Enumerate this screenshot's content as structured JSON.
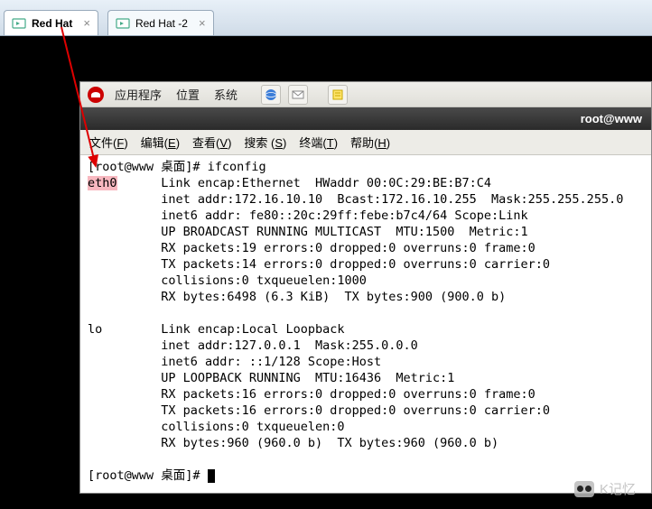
{
  "outer_tabs": [
    {
      "label": "Red Hat",
      "active": true
    },
    {
      "label": "Red Hat -2",
      "active": false
    }
  ],
  "gnome_panel": {
    "apps": "应用程序",
    "places": "位置",
    "system": "系统"
  },
  "window_title": "root@www",
  "menubar": {
    "file": {
      "label": "文件",
      "key": "F"
    },
    "edit": {
      "label": "编辑",
      "key": "E"
    },
    "view": {
      "label": "查看",
      "key": "V"
    },
    "search": {
      "label": "搜索",
      "key": "S"
    },
    "terminal": {
      "label": "终端",
      "key": "T"
    },
    "help": {
      "label": "帮助",
      "key": "H"
    }
  },
  "terminal": {
    "prompt1": "[root@www 桌面]# ifconfig",
    "eth0_label": "eth0",
    "eth0": {
      "l1": "Link encap:Ethernet  HWaddr 00:0C:29:BE:B7:C4",
      "l2": "inet addr:172.16.10.10  Bcast:172.16.10.255  Mask:255.255.255.0",
      "l3": "inet6 addr: fe80::20c:29ff:febe:b7c4/64 Scope:Link",
      "l4": "UP BROADCAST RUNNING MULTICAST  MTU:1500  Metric:1",
      "l5": "RX packets:19 errors:0 dropped:0 overruns:0 frame:0",
      "l6": "TX packets:14 errors:0 dropped:0 overruns:0 carrier:0",
      "l7": "collisions:0 txqueuelen:1000",
      "l8": "RX bytes:6498 (6.3 KiB)  TX bytes:900 (900.0 b)"
    },
    "lo_label": "lo",
    "lo": {
      "l1": "Link encap:Local Loopback",
      "l2": "inet addr:127.0.0.1  Mask:255.0.0.0",
      "l3": "inet6 addr: ::1/128 Scope:Host",
      "l4": "UP LOOPBACK RUNNING  MTU:16436  Metric:1",
      "l5": "RX packets:16 errors:0 dropped:0 overruns:0 frame:0",
      "l6": "TX packets:16 errors:0 dropped:0 overruns:0 carrier:0",
      "l7": "collisions:0 txqueuelen:0",
      "l8": "RX bytes:960 (960.0 b)  TX bytes:960 (960.0 b)"
    },
    "prompt2": "[root@www 桌面]# "
  },
  "watermark": "K记忆"
}
